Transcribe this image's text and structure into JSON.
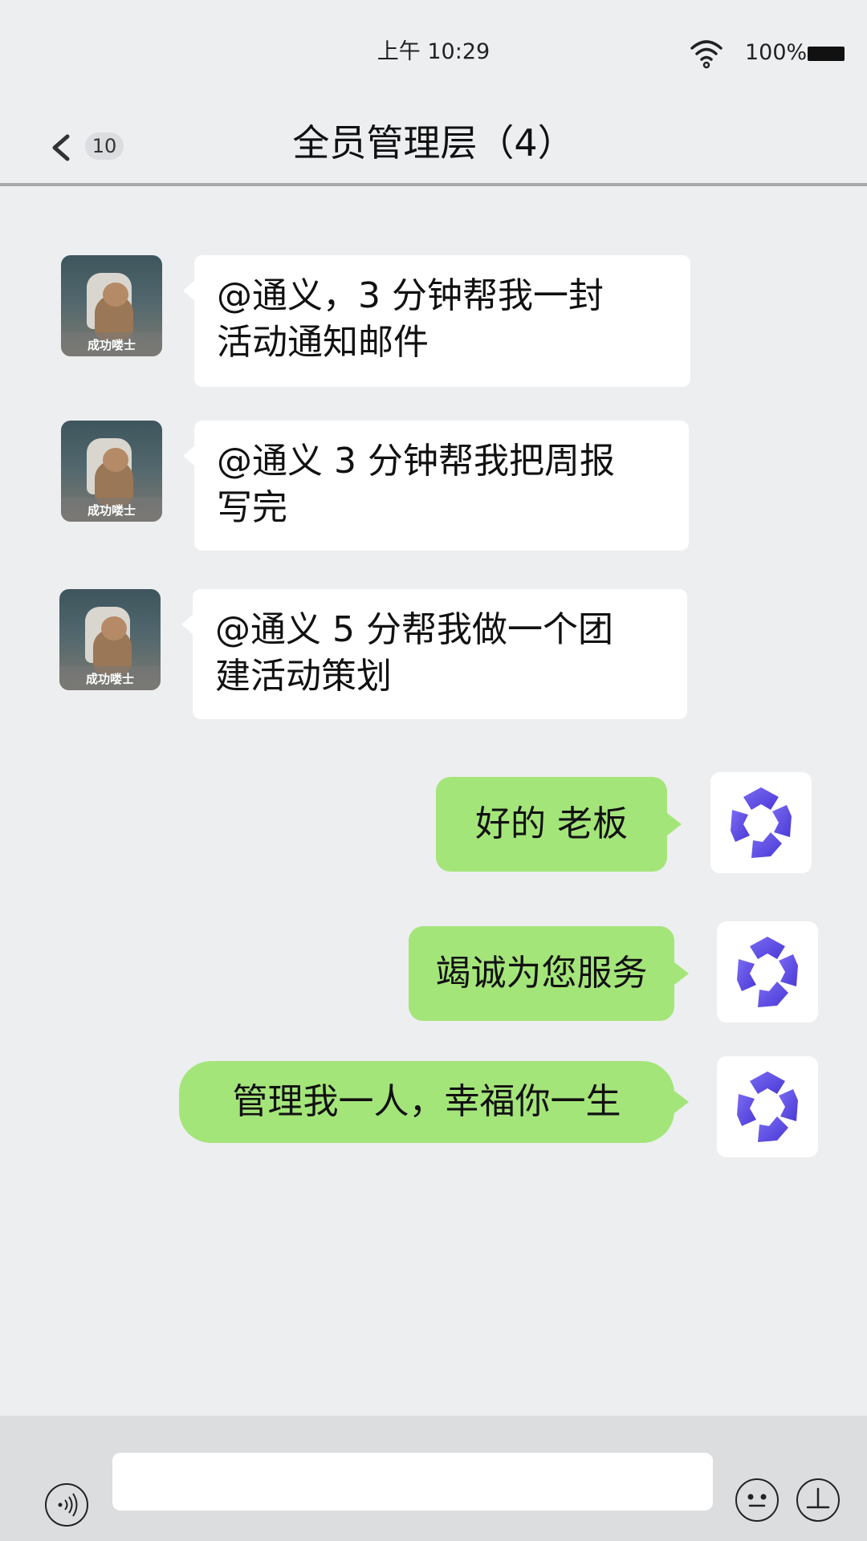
{
  "status_bar": {
    "time": "上午 10:29",
    "battery": "100%",
    "wifi_icon": "wifi-icon",
    "battery_icon": "battery-icon"
  },
  "nav": {
    "back_icon": "chevron-left-icon",
    "unread_count": "10",
    "title": "全员管理层（4）"
  },
  "messages": [
    {
      "side": "left",
      "avatar_caption": "成功喽士",
      "text_lines": [
        "@通义，3 分钟帮我一封",
        "活动通知邮件"
      ]
    },
    {
      "side": "left",
      "avatar_caption": "成功喽士",
      "text_lines": [
        "@通义 3 分钟帮我把周报",
        "写完"
      ]
    },
    {
      "side": "left",
      "avatar_caption": "成功喽士",
      "text_lines": [
        "@通义 5 分帮我做一个团",
        "建活动策划"
      ]
    },
    {
      "side": "right",
      "avatar_icon": "tongyi-logo-icon",
      "text": "好的 老板"
    },
    {
      "side": "right",
      "avatar_icon": "tongyi-logo-icon",
      "text": "竭诚为您服务"
    },
    {
      "side": "right",
      "avatar_icon": "tongyi-logo-icon",
      "text": "管理我一人，幸福你一生"
    }
  ],
  "input_bar": {
    "voice_icon": "voice-icon",
    "input_value": "",
    "emoji_icon": "emoji-icon",
    "plus_icon": "plus-icon"
  },
  "colors": {
    "background": "#edeef0",
    "incoming_bubble": "#ffffff",
    "outgoing_bubble": "#a4e57a",
    "logo_purple": "#5b4be0"
  }
}
